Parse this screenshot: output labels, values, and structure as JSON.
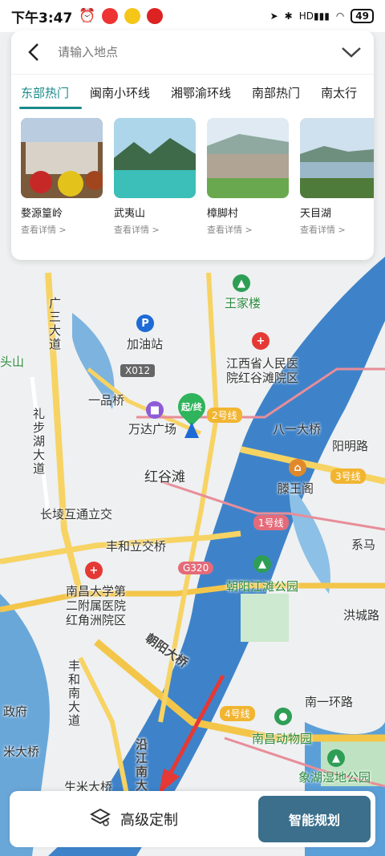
{
  "status_bar": {
    "time": "下午3:47",
    "network": "HD",
    "battery": "49"
  },
  "search": {
    "placeholder": "请输入地点"
  },
  "tabs": [
    {
      "label": "东部热门",
      "active": true
    },
    {
      "label": "闽南小环线"
    },
    {
      "label": "湘鄂渝环线"
    },
    {
      "label": "南部热门"
    },
    {
      "label": "南太行"
    }
  ],
  "destinations": [
    {
      "title": "婺源篁岭",
      "link": "查看详情 >"
    },
    {
      "title": "武夷山",
      "link": "查看详情 >"
    },
    {
      "title": "樟脚村",
      "link": "查看详情 >"
    },
    {
      "title": "天目湖",
      "link": "查看详情 >"
    }
  ],
  "map": {
    "labels": {
      "wangjialou": "王家楼",
      "jiayouzhan": "加油站",
      "hospital1_a": "江西省人民医",
      "hospital1_b": "院红谷滩院区",
      "x012": "X012",
      "yipinqiao": "一品桥",
      "wanda": "万达广场",
      "start": "起/终",
      "line2": "2号线",
      "bayiqiao": "八一大桥",
      "yangminglu": "阳明路",
      "honggutan": "红谷滩",
      "tengwangge": "滕王阁",
      "line3": "3号线",
      "changlinghutong": "长堎互通立交",
      "line1": "1号线",
      "fengheli": "丰和立交桥",
      "g320": "G320",
      "ximalu": "系马",
      "hospital2_a": "南昌大学第",
      "hospital2_b": "二附属医院",
      "hospital2_c": "红角洲院区",
      "chaoyangpark": "朝阳江滩公园",
      "hongchenglu": "洪城路",
      "chaoyangqiao": "朝阳大桥",
      "fenghenan": "丰和南大道",
      "guangsan": "广三大道",
      "lianbu": "礼步湖大道",
      "nanyihuan": "南一环路",
      "line4": "4号线",
      "zoo": "南昌动物园",
      "shijie": "政府",
      "mideqiao": "米大桥",
      "shengmi": "生米大桥",
      "yanjiang": "沿江南大",
      "xiangshu": "象湖湿地公园",
      "toushan": "头山"
    }
  },
  "bottom": {
    "advanced": "高级定制",
    "smart": "智能规划"
  }
}
